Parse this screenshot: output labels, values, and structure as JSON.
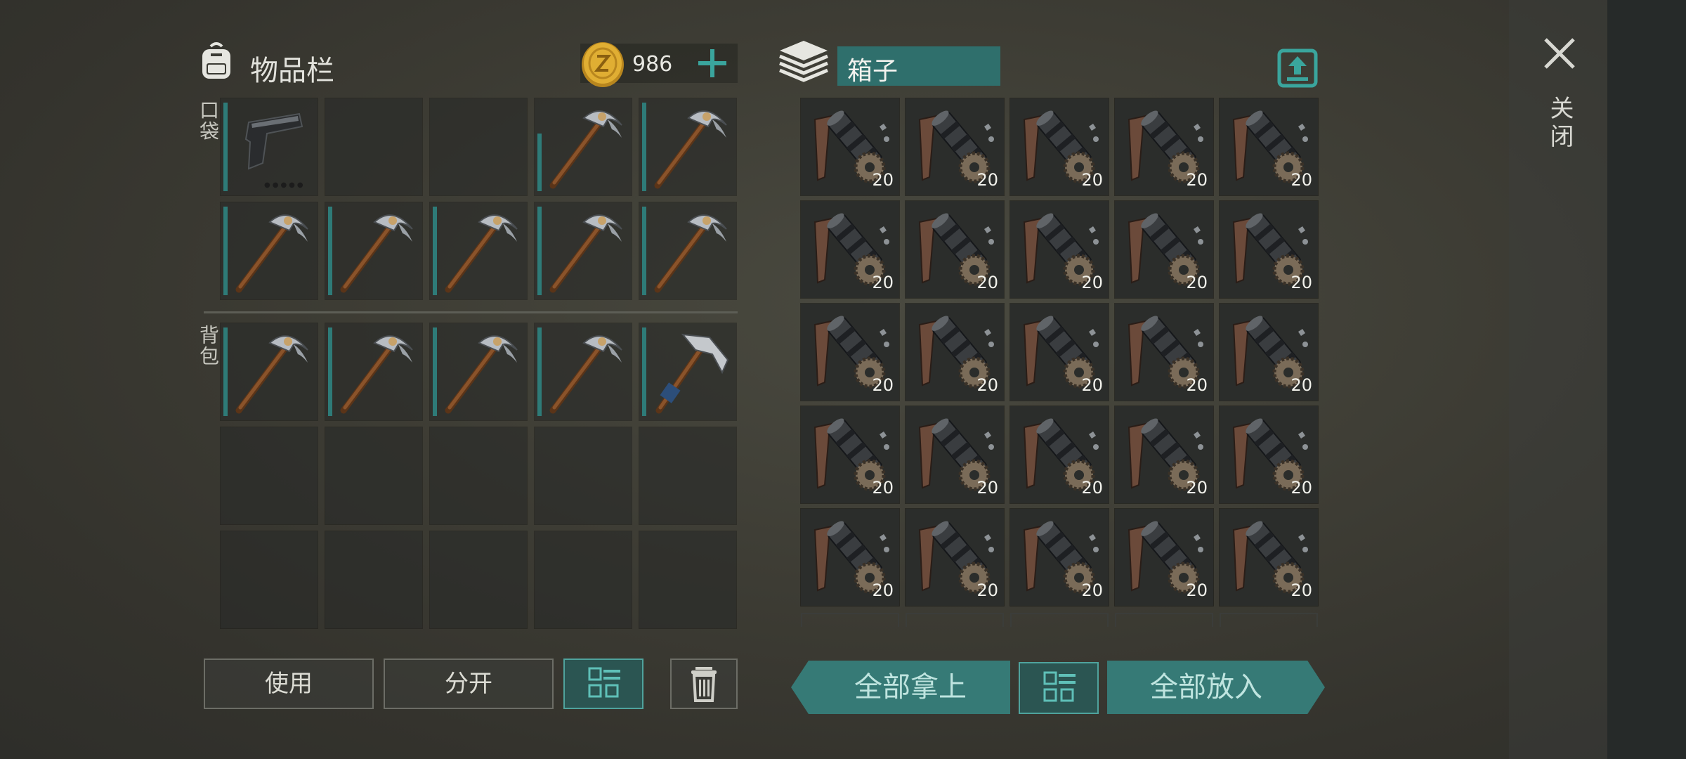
{
  "inventory": {
    "title": "物品栏",
    "coins": "986",
    "pocket_label": "口袋",
    "backpack_label": "背包",
    "pocket_slots": [
      {
        "item": "pistol",
        "bar": "full"
      },
      {
        "item": "empty"
      },
      {
        "item": "empty"
      },
      {
        "item": "pickaxe",
        "bar": "partial"
      },
      {
        "item": "pickaxe",
        "bar": "full"
      },
      {
        "item": "pickaxe",
        "bar": "full"
      },
      {
        "item": "pickaxe",
        "bar": "full"
      },
      {
        "item": "pickaxe",
        "bar": "full"
      },
      {
        "item": "pickaxe",
        "bar": "full"
      },
      {
        "item": "pickaxe",
        "bar": "full"
      }
    ],
    "backpack_slots": [
      {
        "item": "pickaxe",
        "bar": "full"
      },
      {
        "item": "pickaxe",
        "bar": "full"
      },
      {
        "item": "pickaxe",
        "bar": "full"
      },
      {
        "item": "pickaxe",
        "bar": "full"
      },
      {
        "item": "hatchet",
        "bar": "full"
      },
      {
        "item": "empty"
      },
      {
        "item": "empty"
      },
      {
        "item": "empty"
      },
      {
        "item": "empty"
      },
      {
        "item": "empty"
      },
      {
        "item": "empty"
      },
      {
        "item": "empty"
      },
      {
        "item": "empty"
      },
      {
        "item": "empty"
      },
      {
        "item": "empty"
      }
    ]
  },
  "chest": {
    "title": "箱子",
    "item_icon": "tool-parts-icon",
    "slot_count": "20",
    "rows": 5,
    "cols": 5
  },
  "buttons": {
    "use": "使用",
    "split": "分开",
    "take_all": "全部拿上",
    "put_all": "全部放入"
  },
  "close_label": "关闭",
  "colors": {
    "accent": "#2f6f6c",
    "bar": "#2e7b78",
    "coin": "#d9a52a"
  }
}
